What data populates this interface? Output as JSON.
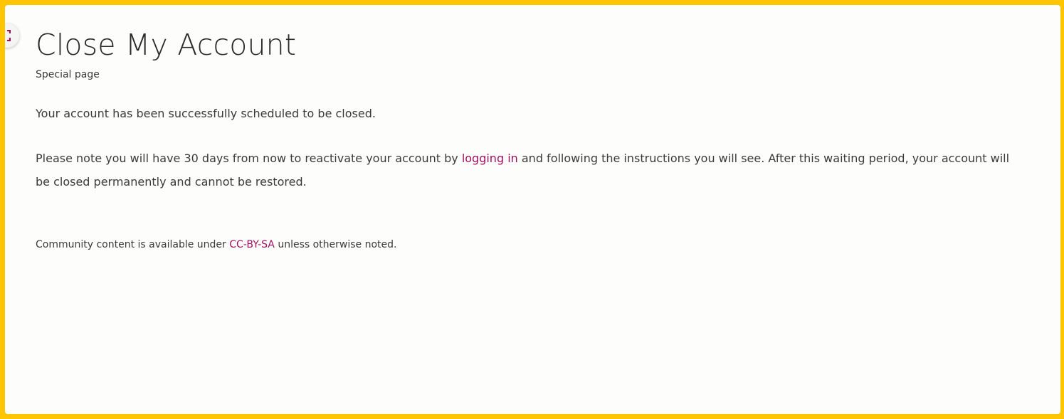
{
  "page": {
    "title": "Close My Account",
    "subtitle": "Special page",
    "message_scheduled": "Your account has been successfully scheduled to be closed.",
    "reactivate_before": "Please note you will have 30 days from now to reactivate your account by ",
    "reactivate_link": "logging in",
    "reactivate_after": " and following the instructions you will see. After this waiting period, your account will be closed permanently and cannot be restored."
  },
  "footer": {
    "license_before": "Community content is available under ",
    "license_link": "CC-BY-SA",
    "license_after": " unless otherwise noted."
  },
  "icons": {
    "expand": "expand-icon"
  },
  "colors": {
    "border": "#ffc500",
    "background": "#fdfefb",
    "link": "#a0105e",
    "text": "#3a3a3a"
  }
}
